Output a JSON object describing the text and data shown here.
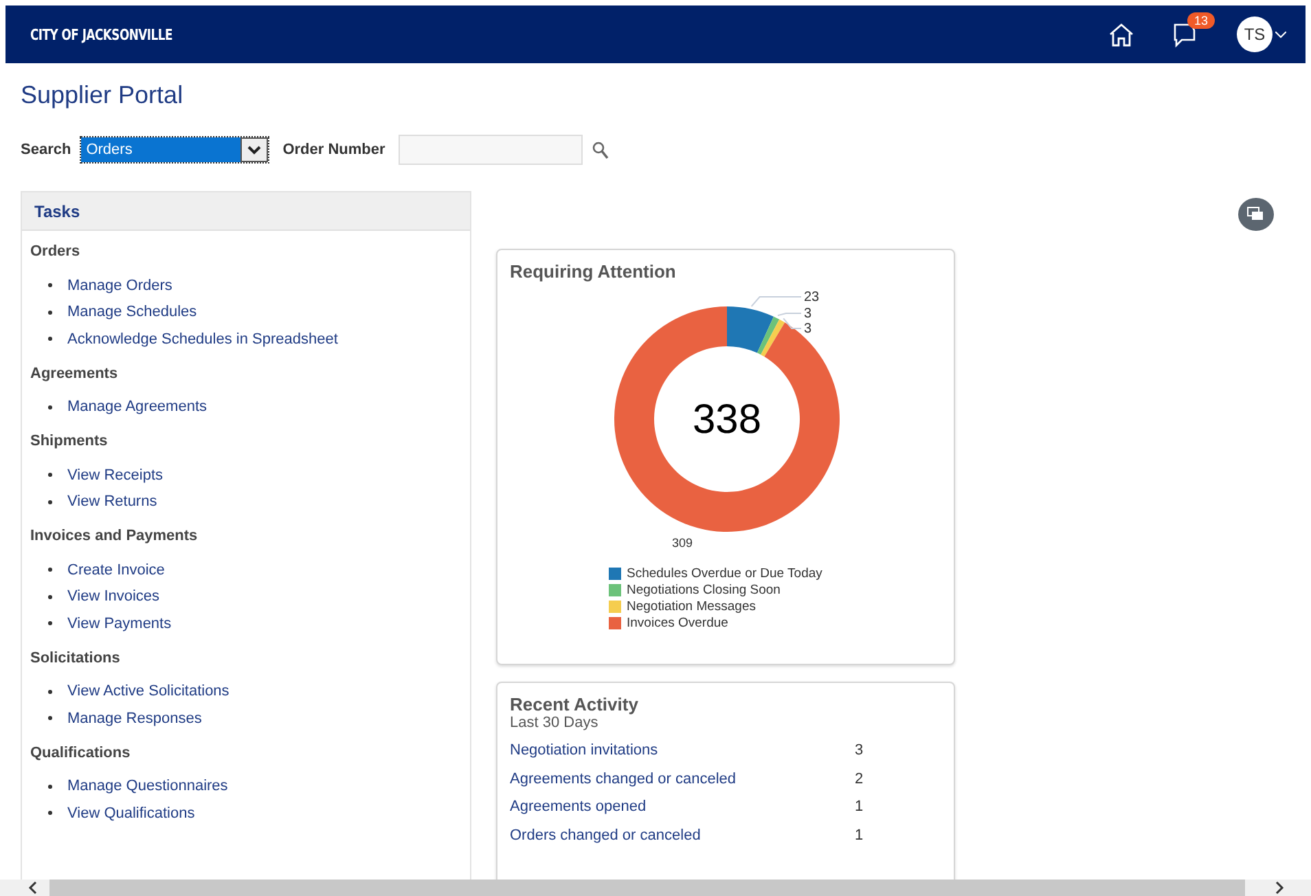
{
  "header": {
    "logo": "CITY OF JACKSONVILLE",
    "notifications_count": "13",
    "avatar_initials": "TS"
  },
  "page_title": "Supplier Portal",
  "search": {
    "label": "Search",
    "value": "Orders",
    "order_number_label": "Order Number"
  },
  "tasks": {
    "title": "Tasks",
    "groups": [
      {
        "heading": "Orders",
        "links": [
          "Manage Orders",
          "Manage Schedules",
          "Acknowledge Schedules in Spreadsheet"
        ]
      },
      {
        "heading": "Agreements",
        "links": [
          "Manage Agreements"
        ]
      },
      {
        "heading": "Shipments",
        "links": [
          "View Receipts",
          "View Returns"
        ]
      },
      {
        "heading": "Invoices and Payments",
        "links": [
          "Create Invoice",
          "View Invoices",
          "View Payments"
        ]
      },
      {
        "heading": "Solicitations",
        "links": [
          "View Active Solicitations",
          "Manage Responses"
        ]
      },
      {
        "heading": "Qualifications",
        "links": [
          "Manage Questionnaires",
          "View Qualifications"
        ]
      }
    ]
  },
  "requiring_attention": {
    "center_label": "338",
    "chart_data": {
      "type": "donut",
      "title": "Requiring Attention",
      "categories": [
        "Schedules Overdue or Due Today",
        "Negotiations Closing Soon",
        "Negotiation Messages",
        "Invoices Overdue"
      ],
      "values": [
        23,
        3,
        3,
        309
      ],
      "data_labels": true
    }
  },
  "slice_colors": [
    {
      "color": "#1f77b4"
    },
    {
      "color": "#6cc27a"
    },
    {
      "color": "#f5cd4f"
    },
    {
      "color": "#e96241"
    }
  ],
  "recent_activity": {
    "title": "Recent Activity",
    "subtitle": "Last 30 Days",
    "rows": [
      {
        "label": "Negotiation invitations",
        "count": "3"
      },
      {
        "label": "Agreements changed or canceled",
        "count": "2"
      },
      {
        "label": "Agreements opened",
        "count": "1"
      },
      {
        "label": "Orders changed or canceled",
        "count": "1"
      }
    ]
  }
}
